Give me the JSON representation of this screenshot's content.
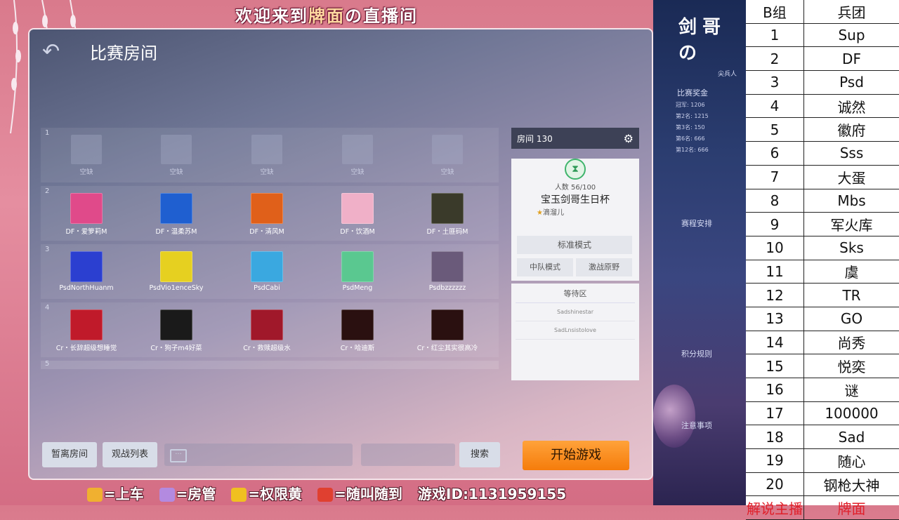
{
  "banner_top": {
    "pre": "欢迎来到",
    "name": "牌面",
    "post": "の直播间"
  },
  "game": {
    "title": "比赛房间",
    "rows": [
      {
        "num": "1",
        "slots": [
          {
            "name": "空缺",
            "color": ""
          },
          {
            "name": "空缺",
            "color": ""
          },
          {
            "name": "空缺",
            "color": ""
          },
          {
            "name": "空缺",
            "color": ""
          },
          {
            "name": "空缺",
            "color": ""
          }
        ]
      },
      {
        "num": "2",
        "slots": [
          {
            "name": "DF・爱箩莉M",
            "color": "#e04a8a"
          },
          {
            "name": "DF・温柔苏M",
            "color": "#1f5fd0"
          },
          {
            "name": "DF・清风M",
            "color": "#e0601a"
          },
          {
            "name": "DF・饮酒M",
            "color": "#f0b0c8"
          },
          {
            "name": "DF・土匪码M",
            "color": "#3a3a2a"
          }
        ]
      },
      {
        "num": "3",
        "slots": [
          {
            "name": "PsdNorthHuanm",
            "color": "#2b3fd0"
          },
          {
            "name": "PsdVio1enceSky",
            "color": "#e6d020"
          },
          {
            "name": "PsdCabi",
            "color": "#3aa8e0"
          },
          {
            "name": "PsdMeng",
            "color": "#5ac890"
          },
          {
            "name": "Psdbzzzzzz",
            "color": "#6a5a7a"
          }
        ]
      },
      {
        "num": "4",
        "slots": [
          {
            "name": "Cr・长辞超级想睡觉",
            "color": "#c01a2a"
          },
          {
            "name": "Cr・狗子m4好菜",
            "color": "#1a1a1a"
          },
          {
            "name": "Cr・救赎超级水",
            "color": "#a0182a"
          },
          {
            "name": "Cr・哈迪斯",
            "color": "#2a1010"
          },
          {
            "name": "Cr・红尘其实很高冷",
            "color": "#2a1010"
          }
        ]
      }
    ],
    "row5_num": "5",
    "side": {
      "room_label": "房间 130",
      "count": "人数 56/100",
      "room_name": "宝玉剑哥生日杯",
      "owner": "滴溜儿",
      "mode_standard": "标准模式",
      "mode_team": "中队模式",
      "mode_wild": "激战原野",
      "waiting_title": "等待区",
      "waiting": [
        "Sadshinestar",
        "SadLnsistolove"
      ]
    },
    "buttons": {
      "leave": "暂离房间",
      "watch": "观战列表",
      "search": "搜索",
      "start": "开始游戏"
    }
  },
  "banner_bottom": {
    "car": "=上车",
    "admin": "=房管",
    "yellow": "=权限黄",
    "call": "=随叫随到",
    "game_id": "游戏ID:1131959155"
  },
  "poster": {
    "title": "剑哥の",
    "subtitle": "尖兵人",
    "prize": "比赛奖金",
    "prize_lines": [
      "冠军: 1206",
      "第2名: 1215",
      "第3名: 150",
      "第6名: 666",
      "第12名: 666"
    ],
    "schedule": "赛程安排",
    "points": "积分规则",
    "notes": "注意事项"
  },
  "table": {
    "header": [
      "B组",
      "兵团"
    ],
    "rows": [
      [
        "1",
        "Sup"
      ],
      [
        "2",
        "DF"
      ],
      [
        "3",
        "Psd"
      ],
      [
        "4",
        "诚然"
      ],
      [
        "5",
        "徽府"
      ],
      [
        "6",
        "Sss"
      ],
      [
        "7",
        "大蛋"
      ],
      [
        "8",
        "Mbs"
      ],
      [
        "9",
        "军火库"
      ],
      [
        "10",
        "Sks"
      ],
      [
        "11",
        "虞"
      ],
      [
        "12",
        "TR"
      ],
      [
        "13",
        "GO"
      ],
      [
        "14",
        "尚秀"
      ],
      [
        "15",
        "悦奕"
      ],
      [
        "16",
        "谜"
      ],
      [
        "17",
        "100000"
      ],
      [
        "18",
        "Sad"
      ],
      [
        "19",
        "随心"
      ],
      [
        "20",
        "钢枪大神"
      ]
    ],
    "footer": [
      "解说主播",
      "牌面"
    ]
  }
}
